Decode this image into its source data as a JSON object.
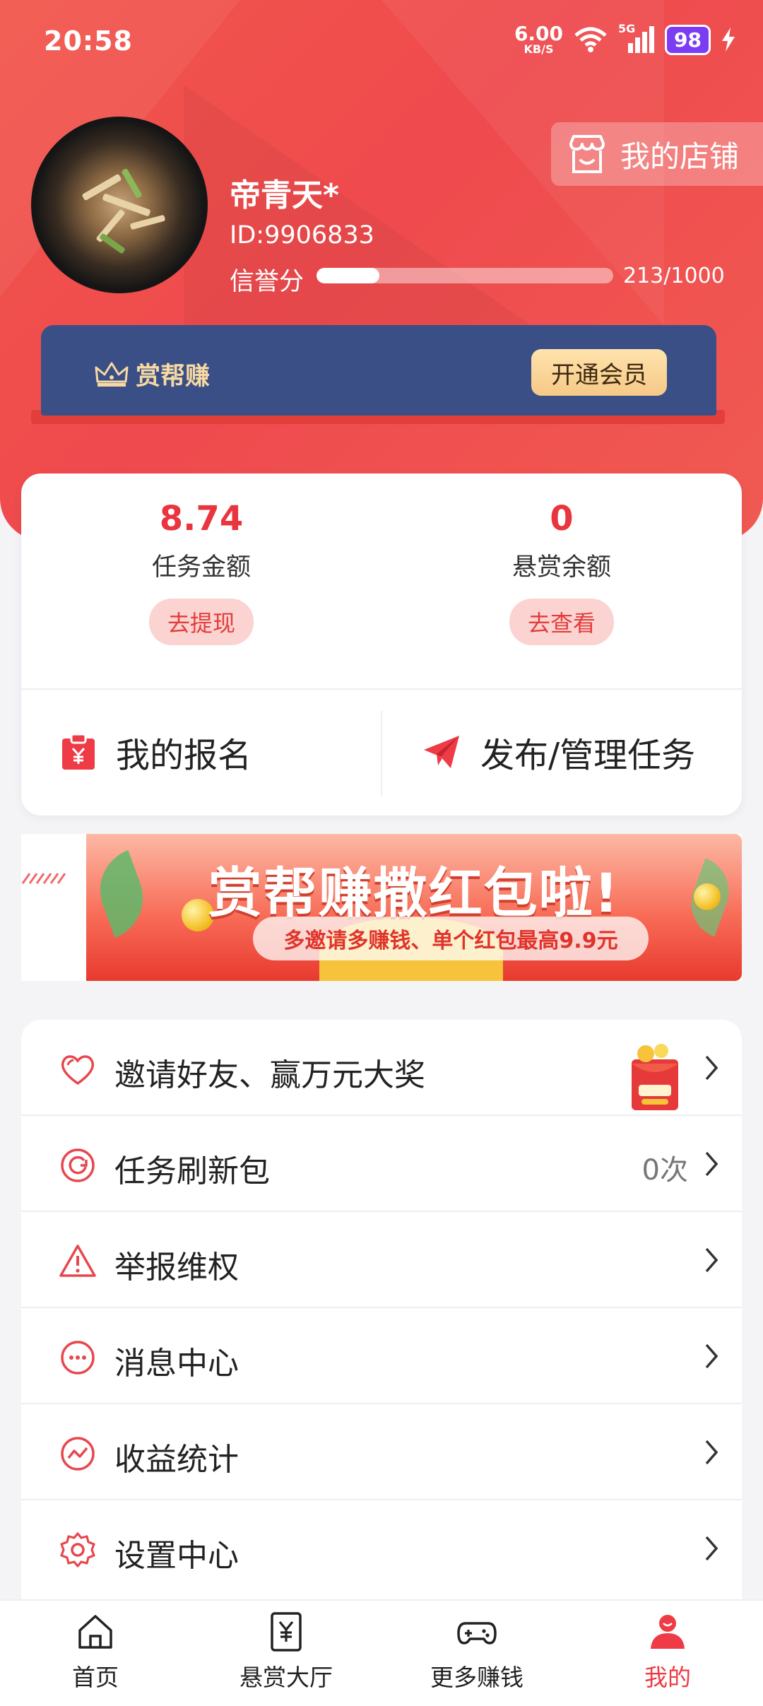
{
  "status_bar": {
    "time": "20:58",
    "net_speed": "6.00",
    "net_unit": "KB/S",
    "signal_label": "5G",
    "battery": "98"
  },
  "profile": {
    "username": "帝青天*",
    "user_id": "ID:9906833",
    "credit_label": "信誉分",
    "credit_value": "213/1000",
    "credit_progress": 0.213,
    "shop_label": "我的店铺"
  },
  "membership": {
    "brand": "赏帮赚",
    "button": "开通会员"
  },
  "balances": {
    "task": {
      "amount": "8.74",
      "label": "任务金额",
      "button": "去提现"
    },
    "reward": {
      "amount": "0",
      "label": "悬赏余额",
      "button": "去查看"
    }
  },
  "actions": {
    "signup": "我的报名",
    "publish": "发布/管理任务"
  },
  "banner": {
    "title": "赏帮赚撒红包啦!",
    "subtitle": "多邀请多赚钱、单个红包最高9.9元"
  },
  "menu": [
    {
      "label": "邀请好友、赢万元大奖",
      "value": ""
    },
    {
      "label": "任务刷新包",
      "value": "0次"
    },
    {
      "label": "举报维权",
      "value": ""
    },
    {
      "label": "消息中心",
      "value": ""
    },
    {
      "label": "收益统计",
      "value": ""
    },
    {
      "label": "设置中心",
      "value": ""
    }
  ],
  "nav": [
    {
      "label": "首页"
    },
    {
      "label": "悬赏大厅"
    },
    {
      "label": "更多赚钱"
    },
    {
      "label": "我的"
    }
  ],
  "colors": {
    "primary_red": "#ef4a4e",
    "member_blue": "#3a4f86",
    "gold": "#f6c987"
  }
}
